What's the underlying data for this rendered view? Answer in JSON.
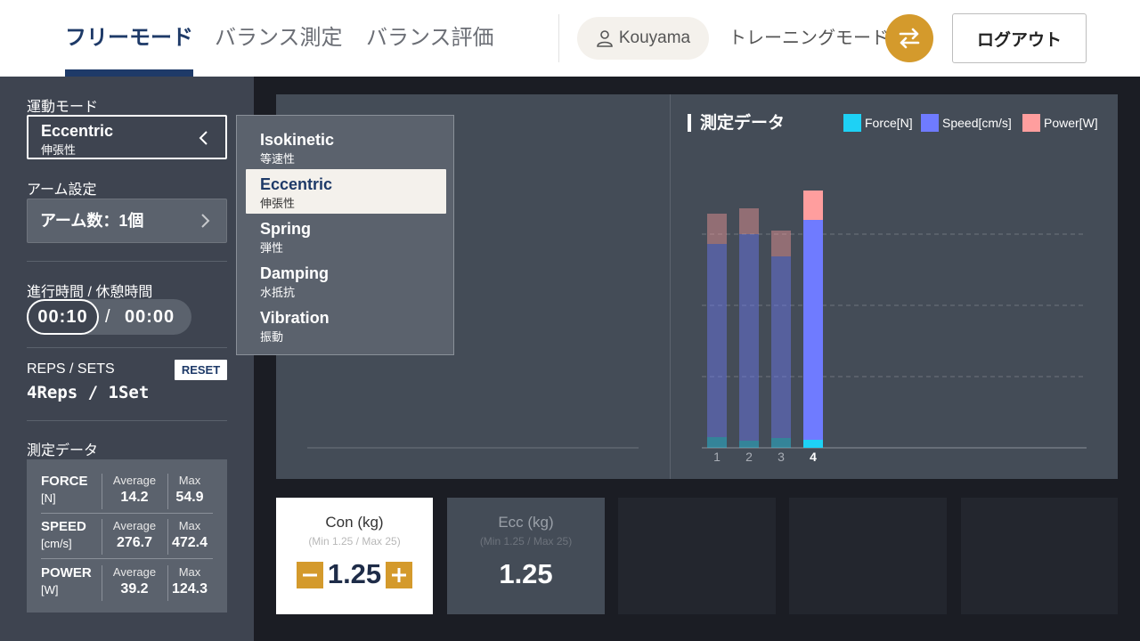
{
  "header": {
    "tabs": [
      {
        "label": "フリーモード",
        "active": true
      },
      {
        "label": "バランス測定",
        "active": false
      },
      {
        "label": "バランス評価",
        "active": false
      }
    ],
    "user_name": "Kouyama",
    "mode_label": "トレーニングモード",
    "logout_label": "ログアウト",
    "icons": {
      "user": "user-icon",
      "switch": "swap-arrows-icon"
    }
  },
  "left": {
    "exercise_mode_label": "運動モード",
    "selected_mode": {
      "name": "Eccentric",
      "sub": "伸張性"
    },
    "arm_label": "アーム設定",
    "arm_value": "アーム数：1個",
    "time_label": "進行時間 / 休憩時間",
    "time_active": "00:10",
    "time_slash": "/",
    "time_rest": "00:00",
    "reps_label": "REPS / SETS",
    "reset_label": "RESET",
    "reps_value": "4Reps / 1Set",
    "measure_label": "測定データ",
    "stats": [
      {
        "name": "FORCE",
        "unit": "[N]",
        "avg_label": "Average",
        "avg": "14.2",
        "max_label": "Max",
        "max": "54.9"
      },
      {
        "name": "SPEED",
        "unit": "[cm/s]",
        "avg_label": "Average",
        "avg": "276.7",
        "max_label": "Max",
        "max": "472.4"
      },
      {
        "name": "POWER",
        "unit": "[W]",
        "avg_label": "Average",
        "avg": "39.2",
        "max_label": "Max",
        "max": "124.3"
      }
    ]
  },
  "dropdown": {
    "items": [
      {
        "name": "Isokinetic",
        "sub": "等速性",
        "selected": false
      },
      {
        "name": "Eccentric",
        "sub": "伸張性",
        "selected": true
      },
      {
        "name": "Spring",
        "sub": "弾性",
        "selected": false
      },
      {
        "name": "Damping",
        "sub": "水抵抗",
        "selected": false
      },
      {
        "name": "Vibration",
        "sub": "振動",
        "selected": false
      }
    ]
  },
  "chart_data": {
    "type": "bar",
    "title": "測定データ",
    "categories": [
      "1",
      "2",
      "3",
      "4"
    ],
    "highlight_category": "4",
    "stacked": true,
    "series": [
      {
        "name": "Force[N]",
        "color": "#1ed1f5",
        "values": [
          12,
          8,
          11,
          9
        ]
      },
      {
        "name": "Speed[cm/s]",
        "color": "#6f7bff",
        "values": [
          217,
          232,
          204,
          247
        ]
      },
      {
        "name": "Power[W]",
        "color": "#ff9e9e",
        "values": [
          34,
          29,
          29,
          33
        ]
      }
    ],
    "ylim": [
      0,
      320
    ],
    "gridlines": [
      80,
      160,
      240
    ],
    "grid": true,
    "legend": "top-right"
  },
  "cards": [
    {
      "title": "Con (kg)",
      "sub": "(Min 1.25 / Max 25)",
      "value": "1.25"
    },
    {
      "title": "Ecc (kg)",
      "sub": "(Min 1.25 / Max 25)",
      "value": "1.25"
    }
  ],
  "colors": {
    "accent": "#d49a2c",
    "navy": "#1e3a68",
    "panel": "#3e4450"
  }
}
